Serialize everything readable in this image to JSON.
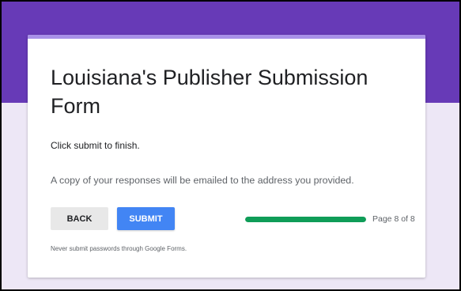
{
  "form": {
    "title": "Louisiana's Publisher Submission Form",
    "finish_message": "Click submit to finish.",
    "copy_notice": "A copy of your responses will be emailed to the address you provided.",
    "back_label": "BACK",
    "submit_label": "SUBMIT",
    "page_indicator": "Page 8 of 8",
    "progress_fraction": 1.0,
    "password_warning": "Never submit passwords through Google Forms."
  },
  "colors": {
    "header_band": "#673ab7",
    "background": "#ede7f6",
    "card_accent": "#a891e8",
    "submit_button": "#4285f4",
    "progress_fill": "#0f9d58"
  }
}
